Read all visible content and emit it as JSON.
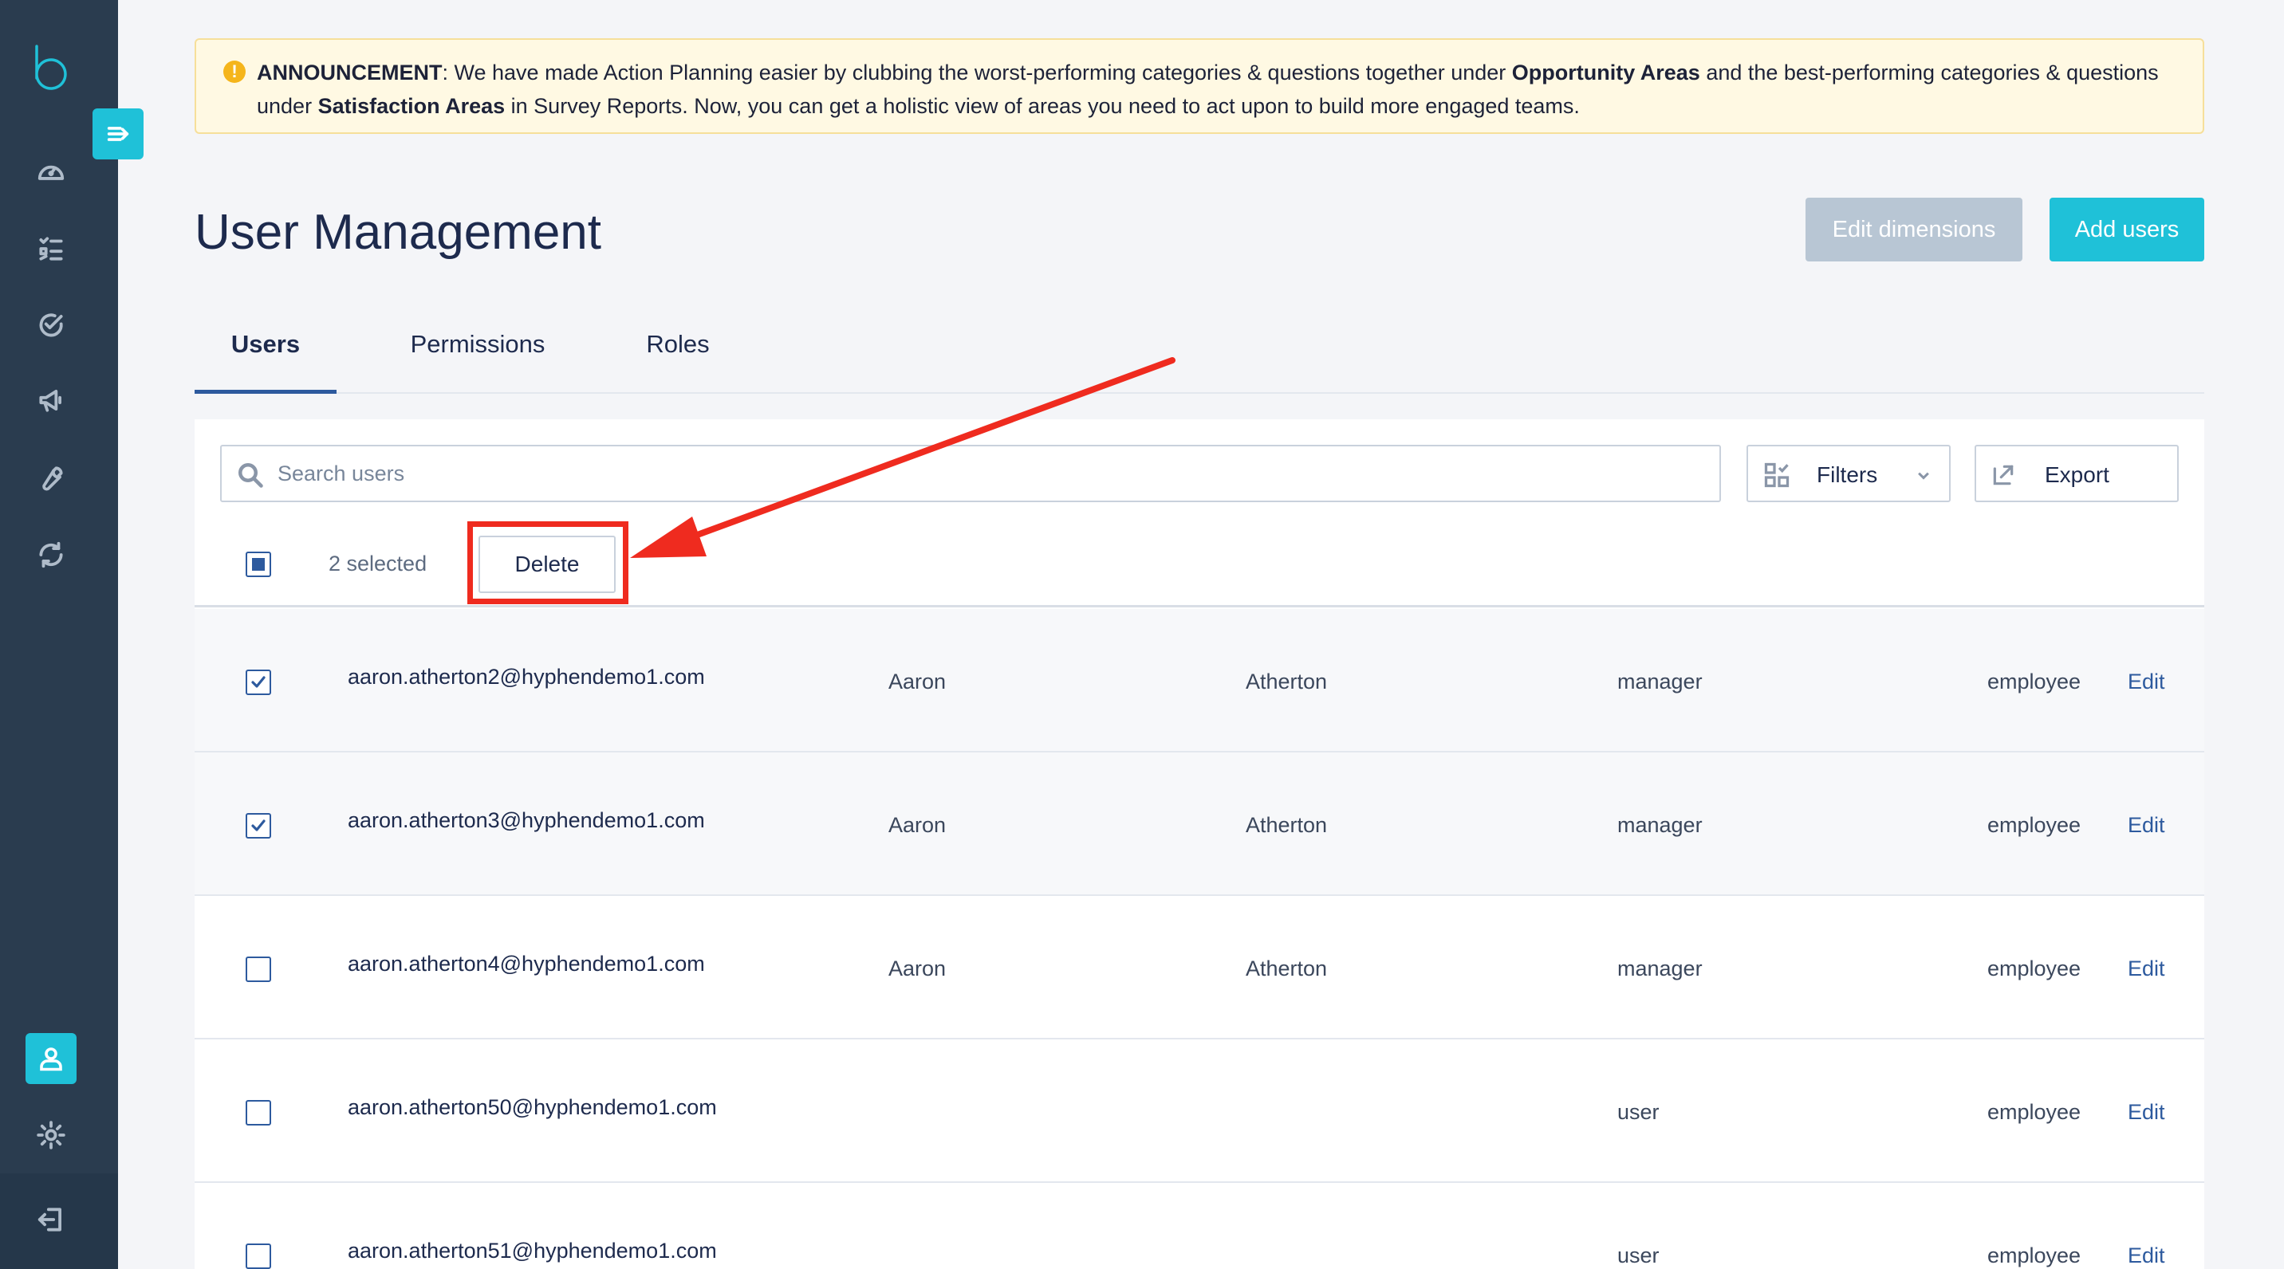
{
  "announcement": {
    "label": "ANNOUNCEMENT",
    "text_1": ": We have made Action Planning easier by clubbing the worst-performing categories & questions  together under ",
    "bold_1": "Opportunity Areas",
    "text_2": " and the best-performing  categories & questions under ",
    "bold_2": "Satisfaction Areas",
    "text_3": " in Survey Reports.  Now, you can get a holistic view of areas you need to act upon to build more engaged teams."
  },
  "header": {
    "title": "User Management",
    "edit_dimensions_label": "Edit dimensions",
    "add_users_label": "Add users"
  },
  "tabs": [
    {
      "label": "Users",
      "active": true
    },
    {
      "label": "Permissions",
      "active": false
    },
    {
      "label": "Roles",
      "active": false
    }
  ],
  "toolbar": {
    "search_placeholder": "Search users",
    "filters_label": "Filters",
    "export_label": "Export"
  },
  "selection": {
    "count_text": "2 selected",
    "delete_label": "Delete"
  },
  "rows": [
    {
      "email": "aaron.atherton2@hyphendemo1.com",
      "first_name": "Aaron",
      "last_name": "Atherton",
      "role": "manager",
      "type": "employee",
      "action": "Edit",
      "checked": true
    },
    {
      "email": "aaron.atherton3@hyphendemo1.com",
      "first_name": "Aaron",
      "last_name": "Atherton",
      "role": "manager",
      "type": "employee",
      "action": "Edit",
      "checked": true
    },
    {
      "email": "aaron.atherton4@hyphendemo1.com",
      "first_name": "Aaron",
      "last_name": "Atherton",
      "role": "manager",
      "type": "employee",
      "action": "Edit",
      "checked": false
    },
    {
      "email": "aaron.atherton50@hyphendemo1.com",
      "first_name": "",
      "last_name": "",
      "role": "user",
      "type": "employee",
      "action": "Edit",
      "checked": false
    },
    {
      "email": "aaron.atherton51@hyphendemo1.com",
      "first_name": "",
      "last_name": "",
      "role": "user",
      "type": "employee",
      "action": "Edit",
      "checked": false
    }
  ],
  "sidebar": {
    "icons": [
      "dashboard-icon",
      "checklist-icon",
      "check-circle-icon",
      "megaphone-icon",
      "wrench-icon",
      "sync-icon",
      "user-icon",
      "gear-icon",
      "logout-icon"
    ]
  },
  "colors": {
    "accent": "#1fc1d8",
    "sidebar": "#2a3c4f",
    "primary_text": "#1d2a4d",
    "link": "#2d5a9e",
    "annotation": "#ef2b1f",
    "announcement_bg": "#fff9e3"
  }
}
